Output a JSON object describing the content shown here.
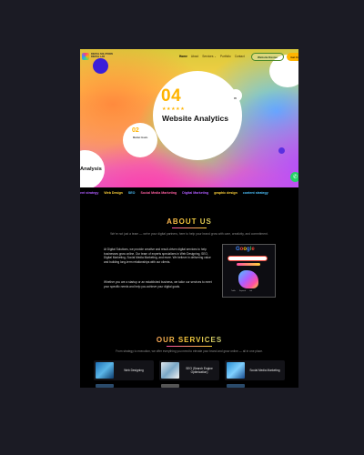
{
  "header": {
    "logo_text": "DIGITAL SOLUTIONS DIGITAL LAB",
    "nav": [
      "Home",
      "About",
      "Services ⌄",
      "Portfolio",
      "Contact"
    ],
    "website_button": "Website Revise",
    "call_button": "Get Call"
  },
  "hero": {
    "number": "04",
    "stars": "★★★★★",
    "title": "Website Analytics",
    "dot_label": "05",
    "small_number": "02",
    "small_label": "Market Goals",
    "left_label": "Analysis"
  },
  "marquee": [
    "ent strategy",
    "Web Design",
    "SEO",
    "Social Media Marketing",
    "Digital Marketing",
    "graphic design",
    "content strategy"
  ],
  "about": {
    "title": "ABOUT US",
    "subtitle": "We're not just a team — we're your digital partners, here to help your brand grow with care, creativity, and commitment.",
    "p1": "At Digital Solutions, we provide creative and result-driven digital services to help businesses grow online. Our team of experts specializes in Web Designing, SEO, Digital Marketing, Social Media Marketing, and more. We believe in delivering value and building long-term relationships with our clients.",
    "p2": "Whether you are a startup or an established business, we tailor our services to meet your specific needs and help you achieve your digital goals.",
    "image_word": "Google",
    "seo_tags": [
      "Traffic",
      "Keyword",
      "Link"
    ]
  },
  "services": {
    "title": "OUR SERVICES",
    "subtitle": "From strategy to execution, we offer everything you need to elevate your brand and grow online — all in one place.",
    "cards": [
      "Web Designing",
      "SEO (Search Engine Optimization)",
      "Social Media Marketing"
    ]
  },
  "colors": {
    "accent": "#ffb400",
    "background": "#000000",
    "brand_pink": "#ff4fa3",
    "whatsapp": "#25d366"
  }
}
